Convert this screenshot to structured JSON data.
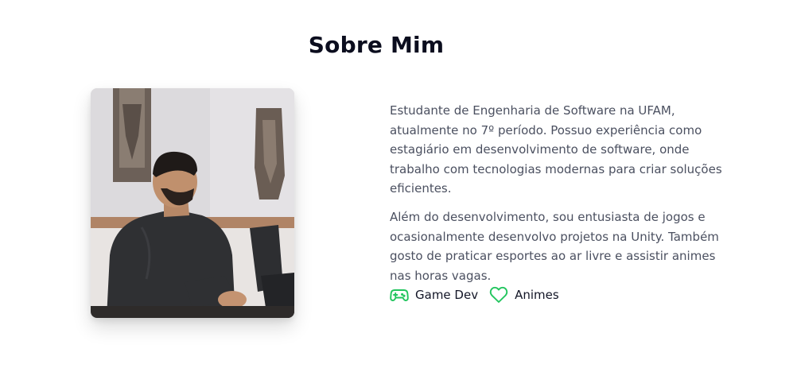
{
  "section": {
    "title": "Sobre Mim"
  },
  "about": {
    "paragraph_1": "Estudante de Engenharia de Software na UFAM, atualmente no 7º período. Possuo experiência como estagiário em desenvolvimento de software, onde trabalho com tecnologias modernas para criar soluções eficientes.",
    "paragraph_2": "Além do desenvolvimento, sou entusiasta de jogos e ocasionalmente desenvolvo projetos na Unity. Também gosto de praticar esportes ao ar livre e assistir animes nas horas vagas."
  },
  "interests": [
    {
      "label": "Game Dev",
      "icon": "gamepad-icon"
    },
    {
      "label": "Animes",
      "icon": "heart-icon"
    }
  ],
  "colors": {
    "accent": "#22c55e",
    "title": "#0b0d1e",
    "body_text": "#4b5060"
  }
}
